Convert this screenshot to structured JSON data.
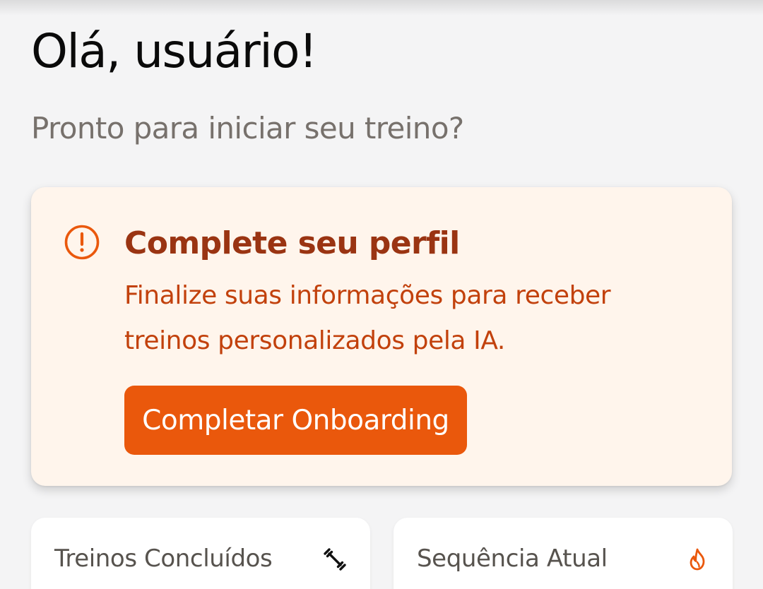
{
  "header": {
    "greeting": "Olá, usuário!",
    "subtitle": "Pronto para iniciar seu treino?"
  },
  "profile_alert": {
    "icon": "alert-circle-icon",
    "title": "Complete seu perfil",
    "description": "Finalize suas informações para receber treinos personalizados pela IA.",
    "button_label": "Completar Onboarding",
    "colors": {
      "background": "#fff5ec",
      "title": "#9a3412",
      "text": "#c2410c",
      "button": "#ea580c"
    }
  },
  "stats": [
    {
      "label": "Treinos Concluídos",
      "icon": "dumbbell-icon"
    },
    {
      "label": "Sequência Atual",
      "icon": "flame-icon",
      "icon_color": "#ea580c"
    }
  ]
}
